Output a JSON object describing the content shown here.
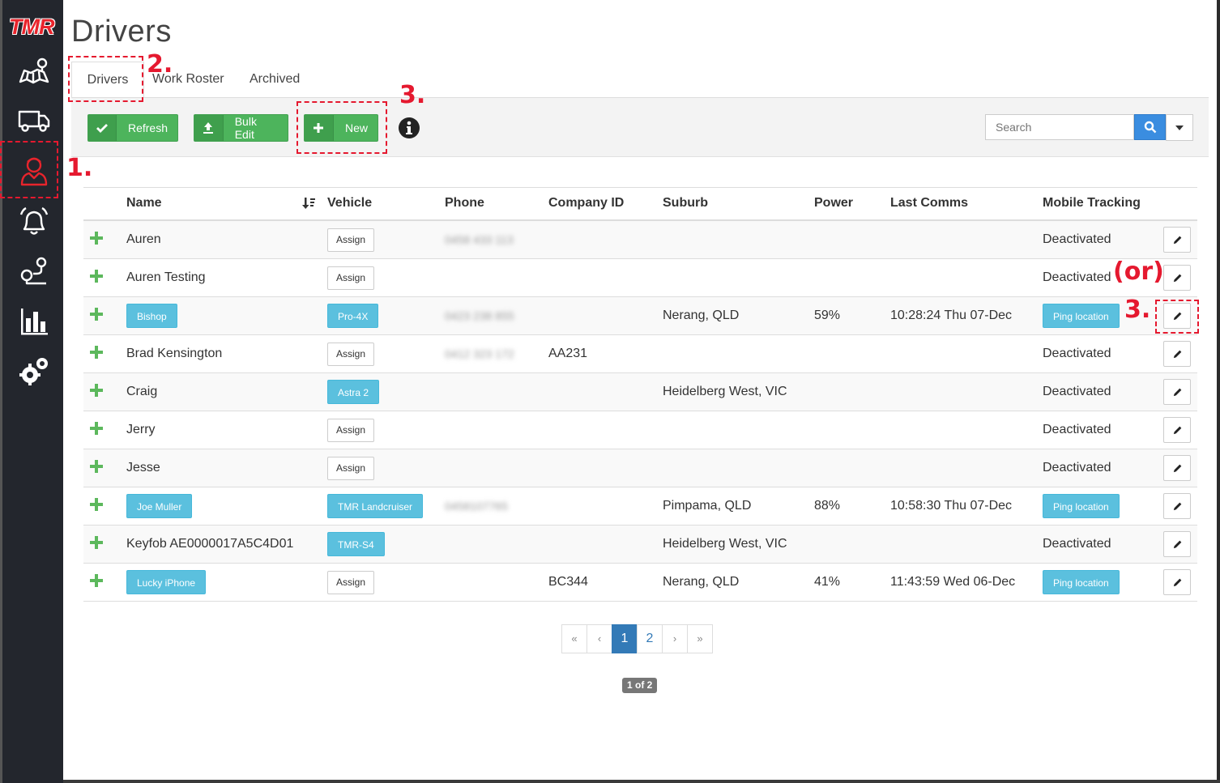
{
  "app": {
    "logo_text": "TMR",
    "accent_color": "#e8242c"
  },
  "sidebar": {
    "items": [
      {
        "name": "map-icon"
      },
      {
        "name": "truck-icon"
      },
      {
        "name": "driver-icon",
        "active": true
      },
      {
        "name": "bell-icon"
      },
      {
        "name": "route-icon"
      },
      {
        "name": "bar-chart-icon"
      },
      {
        "name": "gear-icon"
      }
    ]
  },
  "page": {
    "title": "Drivers"
  },
  "tabs": [
    {
      "label": "Drivers",
      "active": true
    },
    {
      "label": "Work Roster"
    },
    {
      "label": "Archived"
    }
  ],
  "toolbar": {
    "refresh_label": "Refresh",
    "bulk_edit_label": "Bulk Edit",
    "new_label": "New",
    "search_placeholder": "Search"
  },
  "table": {
    "headers": [
      "Name",
      "Vehicle",
      "Phone",
      "Company ID",
      "Suburb",
      "Power",
      "Last Comms",
      "Mobile Tracking"
    ],
    "rows": [
      {
        "name": "Auren",
        "name_badge": false,
        "vehicle": "Assign",
        "vehicle_badge": false,
        "phone": "0458 433 113",
        "company_id": "",
        "suburb": "",
        "power": "",
        "last_comms": "",
        "tracking": "Deactivated",
        "tracking_badge": false
      },
      {
        "name": "Auren Testing",
        "name_badge": false,
        "vehicle": "Assign",
        "vehicle_badge": false,
        "phone": "",
        "company_id": "",
        "suburb": "",
        "power": "",
        "last_comms": "",
        "tracking": "Deactivated",
        "tracking_badge": false
      },
      {
        "name": "Bishop",
        "name_badge": true,
        "vehicle": "Pro-4X",
        "vehicle_badge": true,
        "phone": "0423 238 855",
        "company_id": "",
        "suburb": "Nerang, QLD",
        "power": "59%",
        "last_comms": "10:28:24 Thu 07-Dec",
        "tracking": "Ping location",
        "tracking_badge": true
      },
      {
        "name": "Brad Kensington",
        "name_badge": false,
        "vehicle": "Assign",
        "vehicle_badge": false,
        "phone": "0412 323 172",
        "company_id": "AA231",
        "suburb": "",
        "power": "",
        "last_comms": "",
        "tracking": "Deactivated",
        "tracking_badge": false
      },
      {
        "name": "Craig",
        "name_badge": false,
        "vehicle": "Astra 2",
        "vehicle_badge": true,
        "phone": "",
        "company_id": "",
        "suburb": "Heidelberg West, VIC",
        "power": "",
        "last_comms": "",
        "tracking": "Deactivated",
        "tracking_badge": false
      },
      {
        "name": "Jerry",
        "name_badge": false,
        "vehicle": "Assign",
        "vehicle_badge": false,
        "phone": "",
        "company_id": "",
        "suburb": "",
        "power": "",
        "last_comms": "",
        "tracking": "Deactivated",
        "tracking_badge": false
      },
      {
        "name": "Jesse",
        "name_badge": false,
        "vehicle": "Assign",
        "vehicle_badge": false,
        "phone": "",
        "company_id": "",
        "suburb": "",
        "power": "",
        "last_comms": "",
        "tracking": "Deactivated",
        "tracking_badge": false
      },
      {
        "name": "Joe Muller",
        "name_badge": true,
        "vehicle": "TMR Landcruiser",
        "vehicle_badge": true,
        "phone": "0458107765",
        "company_id": "",
        "suburb": "Pimpama, QLD",
        "power": "88%",
        "last_comms": "10:58:30 Thu 07-Dec",
        "tracking": "Ping location",
        "tracking_badge": true
      },
      {
        "name": "Keyfob AE0000017A5C4D01",
        "name_badge": false,
        "vehicle": "TMR-S4",
        "vehicle_badge": true,
        "phone": "",
        "company_id": "",
        "suburb": "Heidelberg West, VIC",
        "power": "",
        "last_comms": "",
        "tracking": "Deactivated",
        "tracking_badge": false
      },
      {
        "name": "Lucky iPhone",
        "name_badge": true,
        "vehicle": "Assign",
        "vehicle_badge": false,
        "phone": "",
        "company_id": "BC344",
        "suburb": "Nerang, QLD",
        "power": "41%",
        "last_comms": "11:43:59 Wed 06-Dec",
        "tracking": "Ping location",
        "tracking_badge": true
      }
    ]
  },
  "pagination": {
    "first": "«",
    "prev": "‹",
    "pages": [
      "1",
      "2"
    ],
    "current": "1",
    "next": "›",
    "last": "»",
    "label": "1 of 2"
  },
  "annotations": {
    "step1": "1.",
    "step2": "2.",
    "step3_new": "3.",
    "step3_edit": "3.",
    "or_label": "(or)"
  }
}
